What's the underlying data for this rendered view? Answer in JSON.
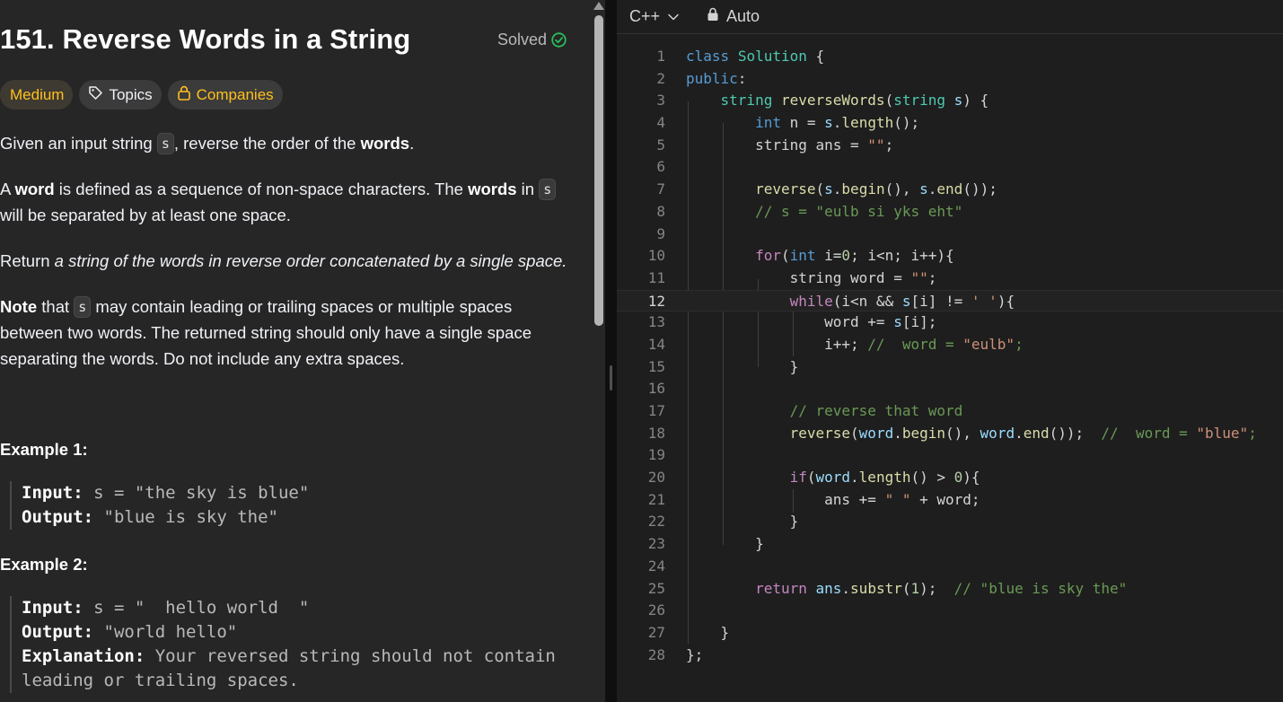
{
  "problem": {
    "title": "151. Reverse Words in a String",
    "solved_label": "Solved",
    "tags": {
      "difficulty": "Medium",
      "topics": "Topics",
      "companies": "Companies"
    },
    "p1_a": "Given an input string ",
    "p1_code": "s",
    "p1_b": ", reverse the order of the ",
    "p1_bold": "words",
    "p1_c": ".",
    "p2_bold1": "A ",
    "p2_word": "word",
    "p2_a": " is defined as a sequence of non-space characters. The ",
    "p2_words": "words",
    "p2_b": " in ",
    "p2_code": "s",
    "p2_c": "will be separated by at least one space.",
    "p3_a": "Return ",
    "p3_i": "a string of the words in reverse order concatenated by a single space.",
    "p4_note": "Note",
    "p4_a": " that ",
    "p4_code": "s",
    "p4_b": " may contain leading or trailing spaces or multiple spaces",
    "p4_c": "between two words. The returned string should only have a single space",
    "p4_d": "separating the words. Do not include any extra spaces.",
    "examples": [
      {
        "heading": "Example 1:",
        "input_label": "Input:",
        "input": " s = \"the sky is blue\"",
        "output_label": "Output:",
        "output": " \"blue is sky the\""
      },
      {
        "heading": "Example 2:",
        "input_label": "Input:",
        "input": " s = \"  hello world  \"",
        "output_label": "Output:",
        "output": " \"world hello\"",
        "explanation_label": "Explanation:",
        "explanation_1": " Your reversed string should not contain",
        "explanation_2": "leading or trailing spaces."
      }
    ]
  },
  "editor": {
    "language": "C++",
    "mode": "Auto",
    "active_line": 12,
    "line_numbers": [
      "1",
      "2",
      "3",
      "4",
      "5",
      "6",
      "7",
      "8",
      "9",
      "10",
      "11",
      "12",
      "13",
      "14",
      "15",
      "16",
      "17",
      "18",
      "19",
      "20",
      "21",
      "22",
      "23",
      "24",
      "25",
      "26",
      "27",
      "28"
    ]
  },
  "colors": {
    "accent_yellow": "#ffc01e",
    "solved_green": "#2cbb5d",
    "keyword": "#569cd6",
    "control": "#c586c0",
    "type": "#4ec9b0",
    "function": "#dcdcaa",
    "variable": "#9cdcfe",
    "string": "#ce9178",
    "comment": "#6a9955"
  }
}
